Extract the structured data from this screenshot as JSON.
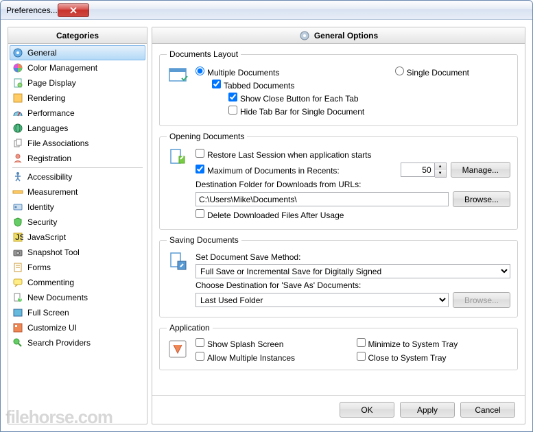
{
  "window": {
    "title": "Preferences..."
  },
  "sidebar": {
    "header": "Categories",
    "items": [
      {
        "label": "General",
        "selected": true
      },
      {
        "label": "Color Management"
      },
      {
        "label": "Page Display"
      },
      {
        "label": "Rendering"
      },
      {
        "label": "Performance"
      },
      {
        "label": "Languages"
      },
      {
        "label": "File Associations"
      },
      {
        "label": "Registration"
      },
      {
        "divider": true
      },
      {
        "label": "Accessibility"
      },
      {
        "label": "Measurement"
      },
      {
        "label": "Identity"
      },
      {
        "label": "Security"
      },
      {
        "label": "JavaScript"
      },
      {
        "label": "Snapshot Tool"
      },
      {
        "label": "Forms"
      },
      {
        "label": "Commenting"
      },
      {
        "label": "New Documents"
      },
      {
        "label": "Full Screen"
      },
      {
        "label": "Customize UI"
      },
      {
        "label": "Search Providers"
      }
    ]
  },
  "main": {
    "header": "General Options",
    "sections": {
      "docLayout": {
        "legend": "Documents Layout",
        "multipleDocs": "Multiple Documents",
        "singleDoc": "Single Document",
        "tabbed": "Tabbed Documents",
        "showClose": "Show Close Button for Each Tab",
        "hideTabBar": "Hide Tab Bar for Single Document"
      },
      "opening": {
        "legend": "Opening Documents",
        "restore": "Restore Last Session when application starts",
        "maxRecent": "Maximum of Documents in Recents:",
        "maxRecentValue": "50",
        "manage": "Manage...",
        "destLabel": "Destination Folder for Downloads from URLs:",
        "destValue": "C:\\Users\\Mike\\Documents\\",
        "browse": "Browse...",
        "deleteAfter": "Delete Downloaded Files After Usage"
      },
      "saving": {
        "legend": "Saving Documents",
        "setMethod": "Set Document Save Method:",
        "methodValue": "Full Save or Incremental Save for Digitally Signed",
        "chooseDest": "Choose Destination for 'Save As' Documents:",
        "destValue": "Last Used Folder",
        "browse": "Browse..."
      },
      "app": {
        "legend": "Application",
        "splash": "Show Splash Screen",
        "allowMulti": "Allow Multiple Instances",
        "minTray": "Minimize to System Tray",
        "closeTray": "Close to System Tray"
      }
    }
  },
  "footer": {
    "ok": "OK",
    "apply": "Apply",
    "cancel": "Cancel"
  },
  "watermark": "filehorse.com"
}
